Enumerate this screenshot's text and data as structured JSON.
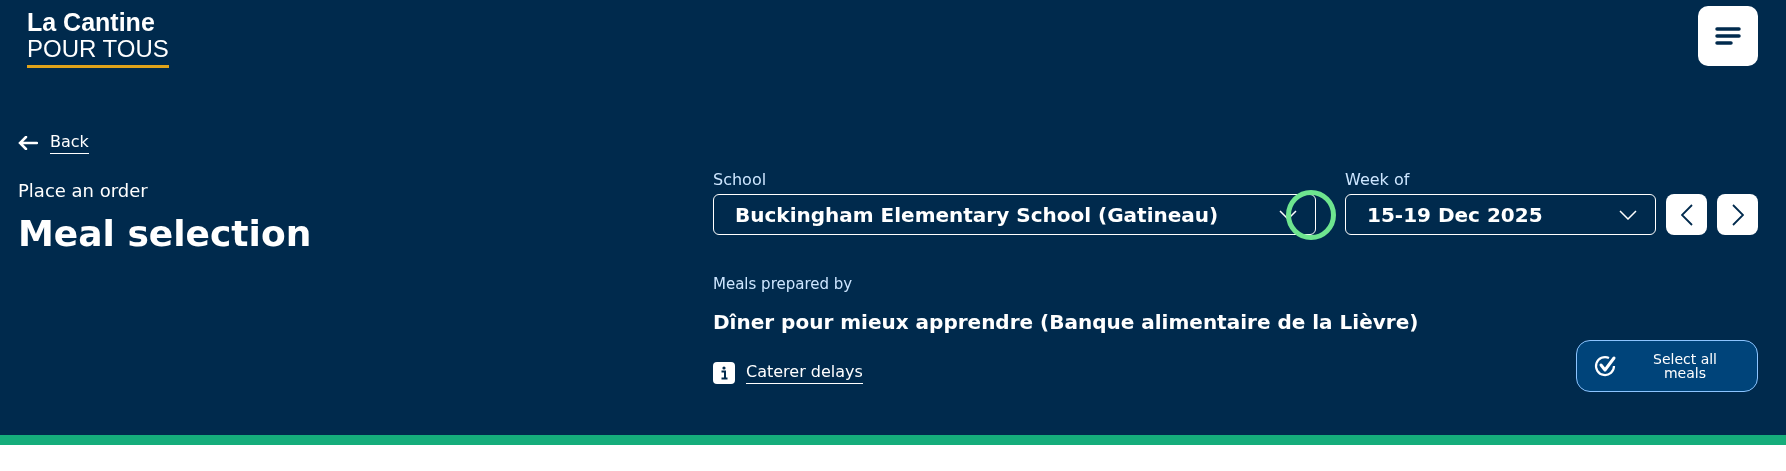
{
  "logo": {
    "line_1": "La Cantine",
    "line_2": "POUR TOUS"
  },
  "back_link": "Back",
  "page": {
    "eyebrow": "Place an order",
    "title": "Meal selection"
  },
  "school": {
    "label": "School",
    "value": "Buckingham Elementary School (Gatineau)",
    "focused": true
  },
  "week": {
    "label": "Week of",
    "value": "15-19 Dec 2025"
  },
  "caterer": {
    "label": "Meals prepared by",
    "name": "Dîner pour mieux apprendre (Banque alimentaire de la Lièvre)",
    "delays_link": "Caterer delays"
  },
  "select_all_button": "Select all meals"
}
